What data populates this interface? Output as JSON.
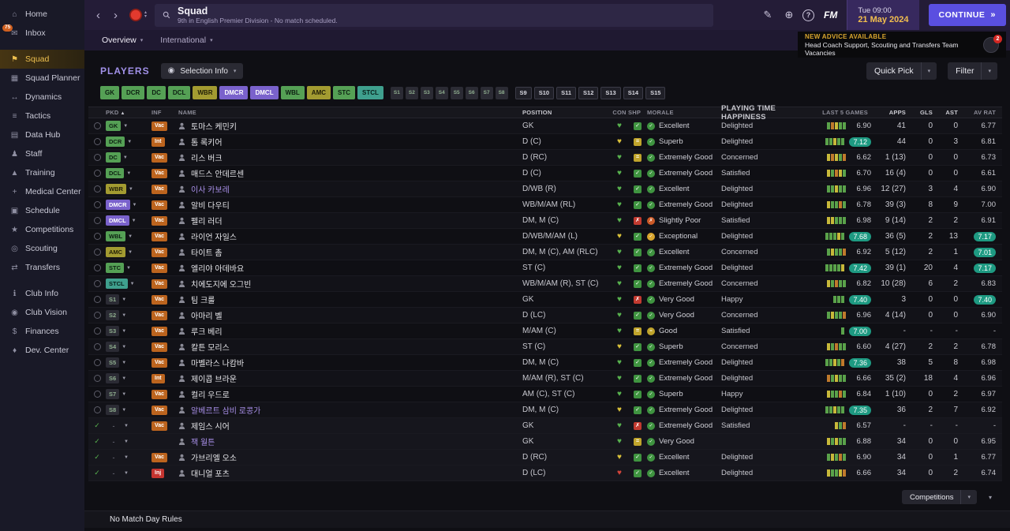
{
  "icons": {
    "back": "‹",
    "forward": "›",
    "stepper_up": "▴",
    "stepper_down": "▾",
    "edit": "✎",
    "world": "⊕",
    "help": "?",
    "dropdown": "▾",
    "menu_dropdown": "▼",
    "sort_asc": "▲",
    "continue_arrow": "»",
    "selection_info_dot": "◉",
    "check": "✓",
    "cross": "✗",
    "equal": "=",
    "heart": "♥"
  },
  "colors": {
    "accent": "#5a4fe0",
    "gold": "#f2bf4e",
    "highlight_rating": "#1e9a82",
    "vac_badge": "#bc641e",
    "inj_badge": "#c43430"
  },
  "sidebar": {
    "items": [
      {
        "label": "Home",
        "icon": "home-icon",
        "glyph": "⌂"
      },
      {
        "label": "Inbox",
        "icon": "inbox-icon",
        "glyph": "✉",
        "badge": "75"
      },
      {
        "label": "Squad",
        "icon": "squad-icon",
        "glyph": "⚑",
        "selected": true,
        "group_start": true
      },
      {
        "label": "Squad Planner",
        "icon": "squad-planner-icon",
        "glyph": "▦"
      },
      {
        "label": "Dynamics",
        "icon": "dynamics-icon",
        "glyph": "↔"
      },
      {
        "label": "Tactics",
        "icon": "tactics-icon",
        "glyph": "≡"
      },
      {
        "label": "Data Hub",
        "icon": "data-hub-icon",
        "glyph": "▤"
      },
      {
        "label": "Staff",
        "icon": "staff-icon",
        "glyph": "♟"
      },
      {
        "label": "Training",
        "icon": "training-icon",
        "glyph": "▲"
      },
      {
        "label": "Medical Center",
        "icon": "medical-center-icon",
        "glyph": "+"
      },
      {
        "label": "Schedule",
        "icon": "schedule-icon",
        "glyph": "▣"
      },
      {
        "label": "Competitions",
        "icon": "competitions-icon",
        "glyph": "★"
      },
      {
        "label": "Scouting",
        "icon": "scouting-icon",
        "glyph": "◎"
      },
      {
        "label": "Transfers",
        "icon": "transfers-icon",
        "glyph": "⇄"
      },
      {
        "label": "Club Info",
        "icon": "club-info-icon",
        "glyph": "ℹ",
        "group_start": true
      },
      {
        "label": "Club Vision",
        "icon": "club-vision-icon",
        "glyph": "◉"
      },
      {
        "label": "Finances",
        "icon": "finances-icon",
        "glyph": "$"
      },
      {
        "label": "Dev. Center",
        "icon": "dev-center-icon",
        "glyph": "♦"
      }
    ]
  },
  "topbar": {
    "title": "Squad",
    "subtitle": "9th in English Premier Division - No match scheduled.",
    "fm": "FM",
    "day_time": "Tue 09:00",
    "date": "21 May 2024",
    "continue_label": "CONTINUE"
  },
  "tabs": {
    "overview": "Overview",
    "international": "International"
  },
  "advice": {
    "heading": "NEW ADVICE AVAILABLE",
    "text": "Head Coach Support, Scouting and Transfers Team Vacancies",
    "badge": "2"
  },
  "players": {
    "title": "PLAYERS",
    "selection_info": "Selection Info",
    "quick_pick": "Quick Pick",
    "filter": "Filter"
  },
  "selection_slots": {
    "starting": [
      {
        "label": "GK",
        "color": "green"
      },
      {
        "label": "DCR",
        "color": "green"
      },
      {
        "label": "DC",
        "color": "green"
      },
      {
        "label": "DCL",
        "color": "green"
      },
      {
        "label": "WBR",
        "color": "olive"
      },
      {
        "label": "DMCR",
        "color": "purple"
      },
      {
        "label": "DMCL",
        "color": "purple"
      },
      {
        "label": "WBL",
        "color": "green"
      },
      {
        "label": "AMC",
        "color": "olive"
      },
      {
        "label": "STC",
        "color": "green"
      },
      {
        "label": "STCL",
        "color": "teal"
      }
    ],
    "subs_picked": [
      "S1",
      "S2",
      "S3",
      "S4",
      "S5",
      "S6",
      "S7",
      "S8"
    ],
    "subs_empty": [
      "S9",
      "S10",
      "S11",
      "S12",
      "S13",
      "S14",
      "S15"
    ]
  },
  "table": {
    "columns": [
      {
        "label": "PKD",
        "sort": "▲"
      },
      {
        "label": "INF"
      },
      {
        "label": "NAME"
      },
      {
        "label": "POSITION"
      },
      {
        "label": "CON"
      },
      {
        "label": "SHP"
      },
      {
        "label": "MORALE"
      },
      {
        "label": "PLAYING TIME HAPPINESS"
      },
      {
        "label": "LAST 5 GAMES"
      },
      {
        "label": "APPS"
      },
      {
        "label": "GLS"
      },
      {
        "label": "AST"
      },
      {
        "label": "AV RAT"
      }
    ],
    "rows": [
      {
        "pkd": "GK",
        "pc": "green",
        "inf": "Vac",
        "name": "토마스 케민키",
        "ns": "normal",
        "pos": "GK",
        "con": "green",
        "shp": "green",
        "mor": "Excellent",
        "mc": "green",
        "happy": "Delighted",
        "bars": [
          "g",
          "o",
          "y",
          "g",
          "g"
        ],
        "l5": "6.90",
        "l5h": false,
        "apps": "41",
        "gls": "0",
        "ast": "0",
        "av": "6.77",
        "avh": false,
        "checked": false
      },
      {
        "pkd": "DCR",
        "pc": "green",
        "inf": "Int",
        "name": "톰 록키어",
        "ns": "normal",
        "pos": "D (C)",
        "con": "yellow",
        "shp": "yellow",
        "mor": "Superb",
        "mc": "green",
        "happy": "Delighted",
        "bars": [
          "g",
          "g",
          "y",
          "g",
          "g"
        ],
        "l5": "7.12",
        "l5h": true,
        "apps": "44",
        "gls": "0",
        "ast": "3",
        "av": "6.81",
        "avh": false,
        "checked": false
      },
      {
        "pkd": "DC",
        "pc": "green",
        "inf": "Vac",
        "name": "리스 버크",
        "ns": "normal",
        "pos": "D (RC)",
        "con": "green",
        "shp": "yellow",
        "mor": "Extremely Good",
        "mc": "green",
        "happy": "Concerned",
        "bars": [
          "y",
          "o",
          "y",
          "g",
          "o"
        ],
        "l5": "6.62",
        "l5h": false,
        "apps": "1 (13)",
        "gls": "0",
        "ast": "0",
        "av": "6.73",
        "avh": false,
        "checked": false
      },
      {
        "pkd": "DCL",
        "pc": "green",
        "inf": "Vac",
        "name": "매드스 안데르센",
        "ns": "normal",
        "pos": "D (C)",
        "con": "green",
        "shp": "green",
        "mor": "Extremely Good",
        "mc": "green",
        "happy": "Satisfied",
        "bars": [
          "y",
          "g",
          "o",
          "y",
          "g"
        ],
        "l5": "6.70",
        "l5h": false,
        "apps": "16 (4)",
        "gls": "0",
        "ast": "0",
        "av": "6.61",
        "avh": false,
        "checked": false
      },
      {
        "pkd": "WBR",
        "pc": "olive",
        "inf": "Vac",
        "name": "이사 카보레",
        "ns": "purple",
        "pos": "D/WB (R)",
        "con": "green",
        "shp": "green",
        "mor": "Excellent",
        "mc": "green",
        "happy": "Delighted",
        "bars": [
          "g",
          "g",
          "y",
          "g",
          "g"
        ],
        "l5": "6.96",
        "l5h": false,
        "apps": "12 (27)",
        "gls": "3",
        "ast": "4",
        "av": "6.90",
        "avh": false,
        "checked": false
      },
      {
        "pkd": "DMCR",
        "pc": "purple",
        "inf": "Vac",
        "name": "알비 다우티",
        "ns": "normal",
        "pos": "WB/M/AM (RL)",
        "con": "green",
        "shp": "green",
        "mor": "Extremely Good",
        "mc": "green",
        "happy": "Delighted",
        "bars": [
          "y",
          "g",
          "g",
          "o",
          "g"
        ],
        "l5": "6.78",
        "l5h": false,
        "apps": "39 (3)",
        "gls": "8",
        "ast": "9",
        "av": "7.00",
        "avh": false,
        "checked": false
      },
      {
        "pkd": "DMCL",
        "pc": "purple",
        "inf": "Vac",
        "name": "펠리 러더",
        "ns": "normal",
        "pos": "DM, M (C)",
        "con": "green",
        "shp": "red",
        "mor": "Slightly Poor",
        "mc": "orange",
        "happy": "Satisfied",
        "bars": [
          "y",
          "y",
          "g",
          "g",
          "g"
        ],
        "l5": "6.98",
        "l5h": false,
        "apps": "9 (14)",
        "gls": "2",
        "ast": "2",
        "av": "6.91",
        "avh": false,
        "checked": false
      },
      {
        "pkd": "WBL",
        "pc": "green",
        "inf": "Vac",
        "name": "라이언 자일스",
        "ns": "normal",
        "pos": "D/WB/M/AM (L)",
        "con": "yellow",
        "shp": "green",
        "mor": "Exceptional",
        "mc": "gold",
        "happy": "Delighted",
        "bars": [
          "g",
          "g",
          "g",
          "y",
          "g"
        ],
        "l5": "7.68",
        "l5h": true,
        "apps": "36 (5)",
        "gls": "2",
        "ast": "13",
        "av": "7.17",
        "avh": true,
        "checked": false
      },
      {
        "pkd": "AMC",
        "pc": "olive",
        "inf": "Vac",
        "name": "타이트 촘",
        "ns": "normal",
        "pos": "DM, M (C), AM (RLC)",
        "con": "green",
        "shp": "green",
        "mor": "Excellent",
        "mc": "green",
        "happy": "Concerned",
        "bars": [
          "g",
          "y",
          "g",
          "g",
          "o"
        ],
        "l5": "6.92",
        "l5h": false,
        "apps": "5 (12)",
        "gls": "2",
        "ast": "1",
        "av": "7.01",
        "avh": true,
        "checked": false
      },
      {
        "pkd": "STC",
        "pc": "green",
        "inf": "Vac",
        "name": "엘리야 아데바요",
        "ns": "normal",
        "pos": "ST (C)",
        "con": "green",
        "shp": "green",
        "mor": "Extremely Good",
        "mc": "green",
        "happy": "Delighted",
        "bars": [
          "g",
          "g",
          "g",
          "g",
          "y"
        ],
        "l5": "7.42",
        "l5h": true,
        "apps": "39 (1)",
        "gls": "20",
        "ast": "4",
        "av": "7.17",
        "avh": true,
        "checked": false
      },
      {
        "pkd": "STCL",
        "pc": "teal",
        "inf": "Vac",
        "name": "치에도지에 오그빈",
        "ns": "normal",
        "pos": "WB/M/AM (R), ST (C)",
        "con": "green",
        "shp": "green",
        "mor": "Extremely Good",
        "mc": "green",
        "happy": "Concerned",
        "bars": [
          "y",
          "g",
          "o",
          "g",
          "g"
        ],
        "l5": "6.82",
        "l5h": false,
        "apps": "10 (28)",
        "gls": "6",
        "ast": "2",
        "av": "6.83",
        "avh": false,
        "checked": false
      },
      {
        "pkd": "S1",
        "pc": "sub",
        "inf": "Vac",
        "name": "팀 크룰",
        "ns": "normal",
        "pos": "GK",
        "con": "green",
        "shp": "red",
        "mor": "Very Good",
        "mc": "green",
        "happy": "Happy",
        "bars": [
          "g",
          "g",
          "g"
        ],
        "l5": "7.40",
        "l5h": true,
        "apps": "3",
        "gls": "0",
        "ast": "0",
        "av": "7.40",
        "avh": true,
        "checked": false
      },
      {
        "pkd": "S2",
        "pc": "sub",
        "inf": "Vac",
        "name": "아마리 벨",
        "ns": "normal",
        "pos": "D (LC)",
        "con": "green",
        "shp": "green",
        "mor": "Very Good",
        "mc": "green",
        "happy": "Concerned",
        "bars": [
          "g",
          "y",
          "g",
          "g",
          "o"
        ],
        "l5": "6.96",
        "l5h": false,
        "apps": "4 (14)",
        "gls": "0",
        "ast": "0",
        "av": "6.90",
        "avh": false,
        "checked": false
      },
      {
        "pkd": "S3",
        "pc": "sub",
        "inf": "Vac",
        "name": "루크 베리",
        "ns": "normal",
        "pos": "M/AM (C)",
        "con": "green",
        "shp": "yellow",
        "mor": "Good",
        "mc": "yellow",
        "happy": "Satisfied",
        "bars": [
          "g"
        ],
        "l5": "7.00",
        "l5h": true,
        "apps": "-",
        "gls": "-",
        "ast": "-",
        "av": "-",
        "avh": false,
        "checked": false
      },
      {
        "pkd": "S4",
        "pc": "sub",
        "inf": "Vac",
        "name": "칼튼 모리스",
        "ns": "normal",
        "pos": "ST (C)",
        "con": "yellow",
        "shp": "green",
        "mor": "Superb",
        "mc": "green",
        "happy": "Concerned",
        "bars": [
          "y",
          "g",
          "o",
          "g",
          "g"
        ],
        "l5": "6.60",
        "l5h": false,
        "apps": "4 (27)",
        "gls": "2",
        "ast": "2",
        "av": "6.78",
        "avh": false,
        "checked": false
      },
      {
        "pkd": "S5",
        "pc": "sub",
        "inf": "Vac",
        "name": "마벨라스 나캄바",
        "ns": "normal",
        "pos": "DM, M (C)",
        "con": "green",
        "shp": "green",
        "mor": "Extremely Good",
        "mc": "green",
        "happy": "Delighted",
        "bars": [
          "g",
          "g",
          "y",
          "g",
          "o"
        ],
        "l5": "7.36",
        "l5h": true,
        "apps": "38",
        "gls": "5",
        "ast": "8",
        "av": "6.98",
        "avh": false,
        "checked": false
      },
      {
        "pkd": "S6",
        "pc": "sub",
        "inf": "Int",
        "name": "제이콥 브라운",
        "ns": "normal",
        "pos": "M/AM (R), ST (C)",
        "con": "green",
        "shp": "green",
        "mor": "Extremely Good",
        "mc": "green",
        "happy": "Delighted",
        "bars": [
          "o",
          "g",
          "y",
          "g",
          "g"
        ],
        "l5": "6.66",
        "l5h": false,
        "apps": "35 (2)",
        "gls": "18",
        "ast": "4",
        "av": "6.96",
        "avh": false,
        "checked": false
      },
      {
        "pkd": "S7",
        "pc": "sub",
        "inf": "Vac",
        "name": "컬리 우드로",
        "ns": "normal",
        "pos": "AM (C), ST (C)",
        "con": "green",
        "shp": "green",
        "mor": "Superb",
        "mc": "green",
        "happy": "Happy",
        "bars": [
          "y",
          "g",
          "g",
          "o",
          "g"
        ],
        "l5": "6.84",
        "l5h": false,
        "apps": "1 (10)",
        "gls": "0",
        "ast": "2",
        "av": "6.97",
        "avh": false,
        "checked": false
      },
      {
        "pkd": "S8",
        "pc": "sub",
        "inf": "Vac",
        "name": "알베르트 삼비 로콩가",
        "ns": "purple",
        "pos": "DM, M (C)",
        "con": "yellow",
        "shp": "green",
        "mor": "Extremely Good",
        "mc": "green",
        "happy": "Delighted",
        "bars": [
          "g",
          "g",
          "y",
          "g",
          "g"
        ],
        "l5": "7.35",
        "l5h": true,
        "apps": "36",
        "gls": "2",
        "ast": "7",
        "av": "6.92",
        "avh": false,
        "checked": false
      },
      {
        "pkd": "",
        "pc": "none",
        "inf": "Vac",
        "name": "제임스 시어",
        "ns": "normal",
        "pos": "GK",
        "con": "green",
        "shp": "red",
        "mor": "Extremely Good",
        "mc": "green",
        "happy": "Satisfied",
        "bars": [
          "y",
          "g",
          "o"
        ],
        "l5": "6.57",
        "l5h": false,
        "apps": "-",
        "gls": "-",
        "ast": "-",
        "av": "-",
        "avh": false,
        "checked": true
      },
      {
        "pkd": "",
        "pc": "none",
        "inf": "",
        "name": "잭 월튼",
        "ns": "purple",
        "pos": "GK",
        "con": "green",
        "shp": "yellow",
        "mor": "Very Good",
        "mc": "green",
        "happy": "",
        "bars": [
          "y",
          "g",
          "y",
          "g",
          "g"
        ],
        "l5": "6.88",
        "l5h": false,
        "apps": "34",
        "gls": "0",
        "ast": "0",
        "av": "6.95",
        "avh": false,
        "checked": true
      },
      {
        "pkd": "",
        "pc": "none",
        "inf": "Vac",
        "name": "가브리엘 오소",
        "ns": "normal",
        "pos": "D (RC)",
        "con": "yellow",
        "shp": "green",
        "mor": "Excellent",
        "mc": "green",
        "happy": "Delighted",
        "bars": [
          "g",
          "y",
          "g",
          "o",
          "g"
        ],
        "l5": "6.90",
        "l5h": false,
        "apps": "34",
        "gls": "0",
        "ast": "1",
        "av": "6.77",
        "avh": false,
        "checked": true
      },
      {
        "pkd": "",
        "pc": "none",
        "inf": "Inj",
        "name": "대니얼 포츠",
        "ns": "normal",
        "pos": "D (LC)",
        "con": "red",
        "shp": "green",
        "mor": "Excellent",
        "mc": "green",
        "happy": "Delighted",
        "bars": [
          "y",
          "g",
          "g",
          "y",
          "o"
        ],
        "l5": "6.66",
        "l5h": false,
        "apps": "34",
        "gls": "0",
        "ast": "2",
        "av": "6.74",
        "avh": false,
        "checked": true
      }
    ]
  },
  "footer": {
    "competitions": "Competitions",
    "no_match_day_rules": "No Match Day Rules"
  }
}
